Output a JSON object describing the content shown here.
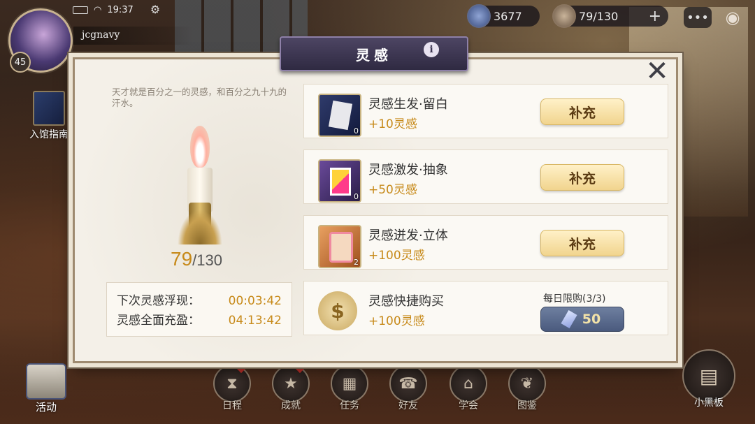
{
  "status": {
    "time": "19:37"
  },
  "player": {
    "name": "jcgnavy",
    "level": "45"
  },
  "currencies": {
    "gems": "3677",
    "inspiration": "79/130"
  },
  "left": {
    "guide_label": "入馆指南",
    "activity_label": "活动"
  },
  "nav": [
    {
      "label": "日程",
      "icon": "⧗"
    },
    {
      "label": "成就",
      "icon": "★"
    },
    {
      "label": "任务",
      "icon": "▦"
    },
    {
      "label": "好友",
      "icon": "☎"
    },
    {
      "label": "学会",
      "icon": "⌂"
    },
    {
      "label": "图鉴",
      "icon": "❦"
    }
  ],
  "blackboard": {
    "label": "小黑板",
    "icon": "▤"
  },
  "dialog": {
    "title": "灵感",
    "info": "i",
    "close": "✕",
    "quote": "天才就是百分之一的灵感，和百分之九十九的汗水。",
    "current": "79",
    "max": "/130",
    "next_label": "下次灵感浮现：",
    "next_value": "00:03:42",
    "full_label": "灵感全面充盈：",
    "full_value": "04:13:42",
    "items": [
      {
        "name": "灵感生发·留白",
        "gain": "+10灵感",
        "qty": "0",
        "button": "补充"
      },
      {
        "name": "灵感激发·抽象",
        "gain": "+50灵感",
        "qty": "0",
        "button": "补充"
      },
      {
        "name": "灵感迸发·立体",
        "gain": "+100灵感",
        "qty": "2",
        "button": "补充"
      }
    ],
    "quick": {
      "name": "灵感快捷购买",
      "gain": "+100灵感",
      "limit": "每日限购(3/3)",
      "price": "50",
      "icon": "$"
    }
  }
}
